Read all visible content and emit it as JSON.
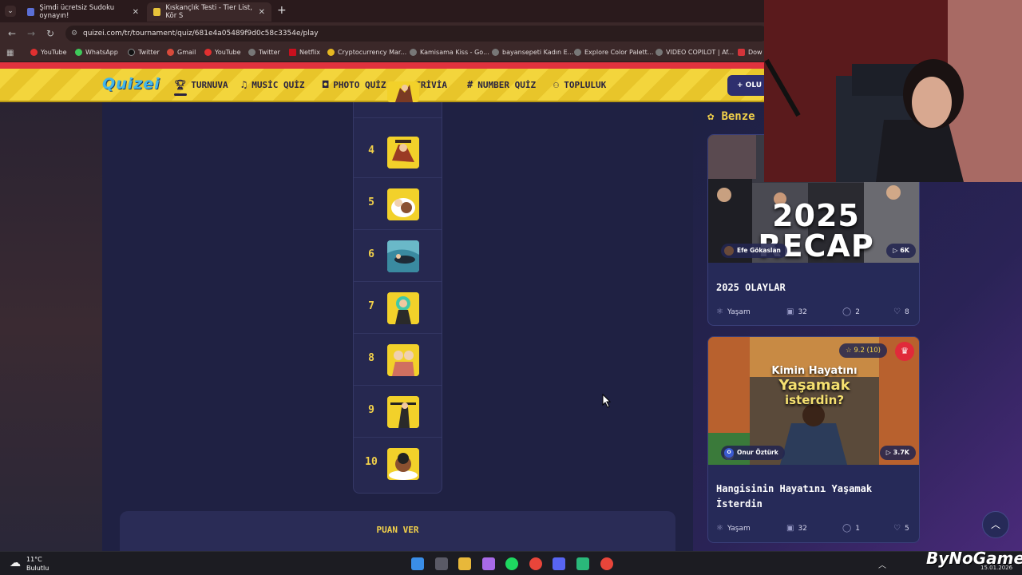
{
  "browser": {
    "tabs": [
      {
        "title": "Şimdi ücretsiz Sudoku oynayın!",
        "active": false
      },
      {
        "title": "Kıskançlık Testi - Tier List, Kör S",
        "active": true
      }
    ],
    "url": "quizei.com/tr/tournament/quiz/681e4a05489f9d0c58c3354e/play",
    "bookmarks": [
      "YouTube",
      "WhatsApp",
      "Twitter",
      "Gmail",
      "YouTube",
      "Twitter",
      "Netflix",
      "Cryptocurrency Mar...",
      "Kamisama Kiss - Go...",
      "bayansepeti Kadın E...",
      "Explore Color Palett...",
      "VIDEO COPILOT | Af...",
      "Dow"
    ]
  },
  "site": {
    "logo": "Quizei",
    "nav": [
      "TURNUVA",
      "MUSİC QUİZ",
      "PHOTO QUİZ",
      "TRİVİA",
      "NUMBER QUİZ",
      "TOPLULUK"
    ],
    "create_label": "+ OLU"
  },
  "ranking": {
    "items": [
      {
        "rank": "4"
      },
      {
        "rank": "5"
      },
      {
        "rank": "6"
      },
      {
        "rank": "7"
      },
      {
        "rank": "8"
      },
      {
        "rank": "9"
      },
      {
        "rank": "10"
      }
    ]
  },
  "rate": {
    "title": "PUAN VER"
  },
  "similar": {
    "title": "Benze",
    "cards": [
      {
        "image_text": "2025 RECAP",
        "author": "Efe Gökaslan",
        "plays": "6K",
        "title": "2025 OLAYLAR",
        "category": "Yaşam",
        "count": "32",
        "comments": "2",
        "likes": "8"
      },
      {
        "image_text_1": "Kimin Hayatını",
        "image_text_2": "Yaşamak",
        "image_text_3": "isterdin?",
        "rating": "9.2 (10)",
        "author": "Onur Öztürk",
        "author_initial": "O",
        "plays": "3.7K",
        "title_line1": "Hangisinin Hayatını Yaşamak",
        "title_line2": "İsterdin",
        "category": "Yaşam",
        "count": "32",
        "comments": "1",
        "likes": "5"
      }
    ]
  },
  "taskbar": {
    "weather_temp": "11°C",
    "weather_desc": "Bulutlu",
    "watermark": "ByNoGame",
    "date": "15.01.2026"
  },
  "colors": {
    "accent_yellow": "#f2d14a",
    "header_yellow": "#f3d53c",
    "bg_navy": "#1f2143",
    "brand_red": "#e0323e"
  }
}
